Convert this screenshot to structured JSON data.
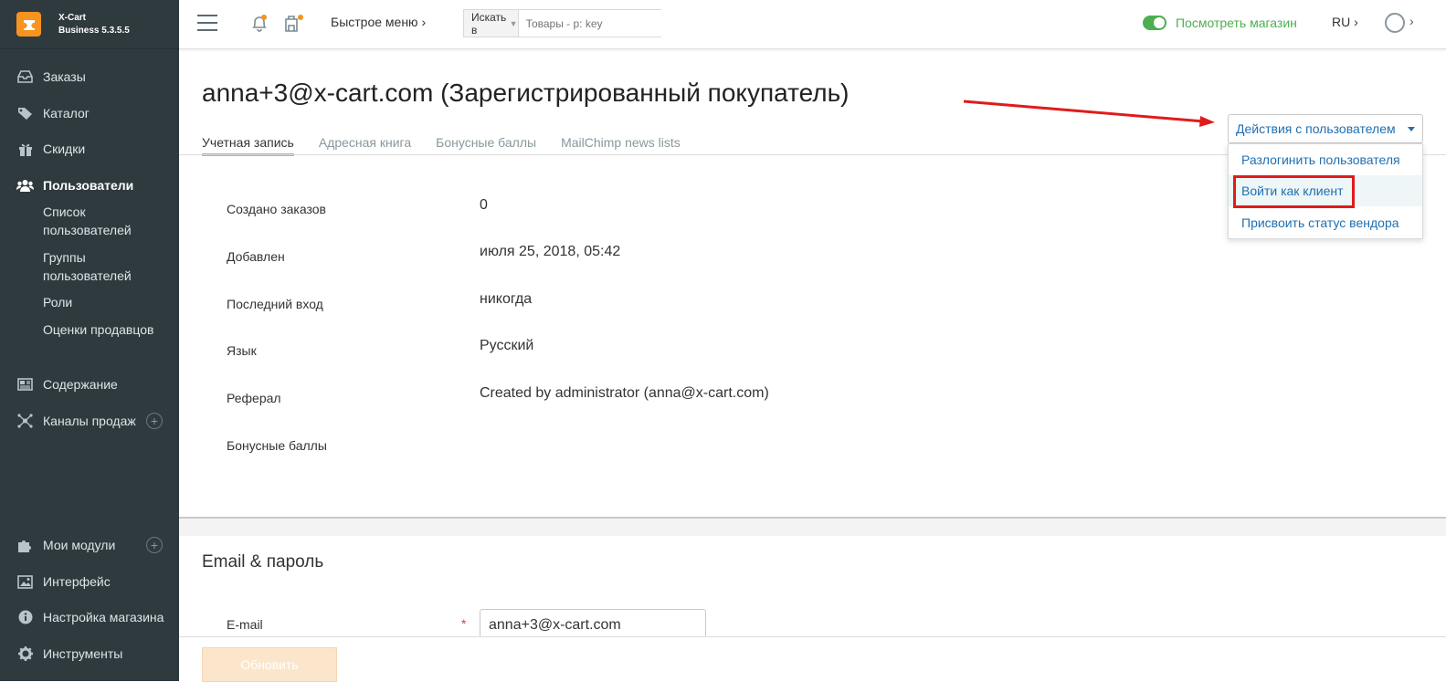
{
  "brand": {
    "name": "X-Cart",
    "edition": "Business 5.3.5.5"
  },
  "sidebar": {
    "items": [
      {
        "label": "Заказы",
        "icon": "inbox-icon"
      },
      {
        "label": "Каталог",
        "icon": "tag-icon"
      },
      {
        "label": "Скидки",
        "icon": "gift-icon"
      },
      {
        "label": "Пользователи",
        "icon": "users-icon"
      },
      {
        "label": "Содержание",
        "icon": "newspaper-icon"
      },
      {
        "label": "Каналы продаж",
        "icon": "network-icon"
      },
      {
        "label": "Мои модули",
        "icon": "puzzle-icon"
      },
      {
        "label": "Интерфейс",
        "icon": "image-icon"
      },
      {
        "label": "Настройка магазина",
        "icon": "info-icon"
      },
      {
        "label": "Инструменты",
        "icon": "gear-icon"
      }
    ],
    "subitems": [
      "Список пользователей",
      "Группы пользователей",
      "Роли",
      "Оценки продавцов"
    ]
  },
  "topbar": {
    "quick_menu": "Быстрое меню",
    "search_in": "Искать в",
    "search_placeholder": "Товары - p: key",
    "view_store": "Посмотреть магазин",
    "lang": "RU"
  },
  "page": {
    "title": "anna+3@x-cart.com (Зарегистрированный покупатель)",
    "tabs": [
      "Учетная запись",
      "Адресная книга",
      "Бонусные баллы",
      "MailChimp news lists"
    ]
  },
  "fields": [
    {
      "label": "Создано заказов",
      "value": "0"
    },
    {
      "label": "Добавлен",
      "value": "июля 25, 2018, 05:42"
    },
    {
      "label": "Последний вход",
      "value": "никогда"
    },
    {
      "label": "Язык",
      "value": "Русский"
    },
    {
      "label": "Реферал",
      "value": "Created by administrator (anna@x-cart.com)"
    },
    {
      "label": "Бонусные баллы",
      "value": ""
    }
  ],
  "email_section": {
    "title": "Email & пароль",
    "email_label": "E-mail",
    "required_mark": "*",
    "email_value": "anna+3@x-cart.com"
  },
  "update_button": "Обновить",
  "actions": {
    "button": "Действия с пользователем",
    "items": [
      "Разлогинить пользователя",
      "Войти как клиент",
      "Присвоить статус вендора"
    ]
  },
  "colors": {
    "sidebar_bg": "#2f3a3f",
    "accent_link": "#1f6fb2",
    "store_green": "#4caf50",
    "logo_orange": "#f7931e",
    "annotation_red": "#e01b1b"
  }
}
